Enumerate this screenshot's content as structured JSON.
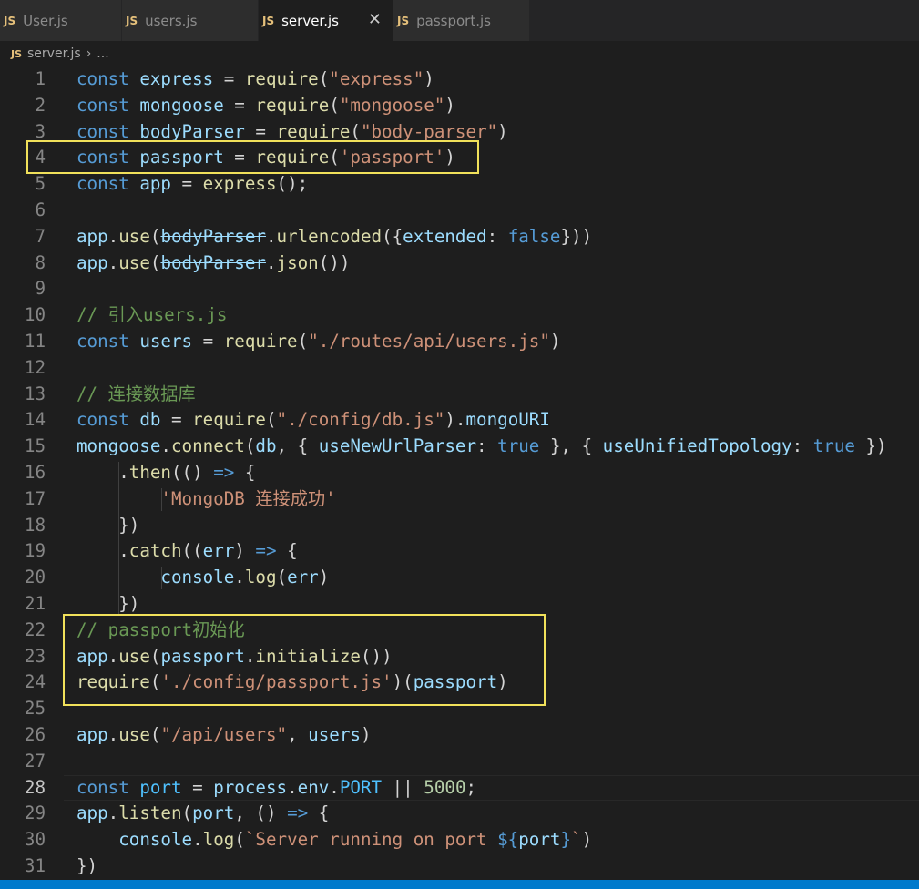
{
  "tabs": [
    {
      "icon": "JS",
      "label": "User.js",
      "active": false
    },
    {
      "icon": "JS",
      "label": "users.js",
      "active": false
    },
    {
      "icon": "JS",
      "label": "server.js",
      "active": true,
      "close": "✕"
    },
    {
      "icon": "JS",
      "label": "passport.js",
      "active": false
    }
  ],
  "breadcrumb": {
    "icon": "JS",
    "file": "server.js",
    "sep": "›",
    "more": "..."
  },
  "lines": [
    {
      "n": "1",
      "t": [
        [
          "kw",
          "const"
        ],
        [
          "p",
          " "
        ],
        [
          "var",
          "express"
        ],
        [
          "p",
          " = "
        ],
        [
          "fn",
          "require"
        ],
        [
          "p",
          "("
        ],
        [
          "str",
          "\"express\""
        ],
        [
          "p",
          ")"
        ]
      ]
    },
    {
      "n": "2",
      "t": [
        [
          "kw",
          "const"
        ],
        [
          "p",
          " "
        ],
        [
          "var",
          "mongoose"
        ],
        [
          "p",
          " = "
        ],
        [
          "fn",
          "require"
        ],
        [
          "p",
          "("
        ],
        [
          "str",
          "\"mongoose\""
        ],
        [
          "p",
          ")"
        ]
      ]
    },
    {
      "n": "3",
      "t": [
        [
          "kw",
          "const"
        ],
        [
          "p",
          " "
        ],
        [
          "var",
          "bodyParser"
        ],
        [
          "p",
          " = "
        ],
        [
          "fn",
          "require"
        ],
        [
          "p",
          "("
        ],
        [
          "str",
          "\"body-parser\""
        ],
        [
          "p",
          ")"
        ]
      ]
    },
    {
      "n": "4",
      "t": [
        [
          "kw",
          "const"
        ],
        [
          "p",
          " "
        ],
        [
          "var",
          "passport"
        ],
        [
          "p",
          " = "
        ],
        [
          "fn",
          "require"
        ],
        [
          "p",
          "("
        ],
        [
          "str",
          "'passport'"
        ],
        [
          "p",
          ")"
        ]
      ]
    },
    {
      "n": "5",
      "t": [
        [
          "kw",
          "const"
        ],
        [
          "p",
          " "
        ],
        [
          "var",
          "app"
        ],
        [
          "p",
          " = "
        ],
        [
          "fn",
          "express"
        ],
        [
          "p",
          "();"
        ]
      ]
    },
    {
      "n": "6",
      "t": []
    },
    {
      "n": "7",
      "t": [
        [
          "var",
          "app"
        ],
        [
          "p",
          "."
        ],
        [
          "fn",
          "use"
        ],
        [
          "p",
          "("
        ],
        [
          "var strike",
          "bodyParser"
        ],
        [
          "p",
          "."
        ],
        [
          "fn",
          "urlencoded"
        ],
        [
          "p",
          "({"
        ],
        [
          "var",
          "extended"
        ],
        [
          "p",
          ": "
        ],
        [
          "kw",
          "false"
        ],
        [
          "p",
          "}))"
        ]
      ]
    },
    {
      "n": "8",
      "t": [
        [
          "var",
          "app"
        ],
        [
          "p",
          "."
        ],
        [
          "fn",
          "use"
        ],
        [
          "p",
          "("
        ],
        [
          "var strike",
          "bodyParser"
        ],
        [
          "p",
          "."
        ],
        [
          "fn",
          "json"
        ],
        [
          "p",
          "())"
        ]
      ]
    },
    {
      "n": "9",
      "t": []
    },
    {
      "n": "10",
      "t": [
        [
          "cmt",
          "// 引入users.js"
        ]
      ]
    },
    {
      "n": "11",
      "t": [
        [
          "kw",
          "const"
        ],
        [
          "p",
          " "
        ],
        [
          "var",
          "users"
        ],
        [
          "p",
          " = "
        ],
        [
          "fn",
          "require"
        ],
        [
          "p",
          "("
        ],
        [
          "str",
          "\"./routes/api/users.js\""
        ],
        [
          "p",
          ")"
        ]
      ]
    },
    {
      "n": "12",
      "t": []
    },
    {
      "n": "13",
      "t": [
        [
          "cmt",
          "// 连接数据库"
        ]
      ]
    },
    {
      "n": "14",
      "t": [
        [
          "kw",
          "const"
        ],
        [
          "p",
          " "
        ],
        [
          "var",
          "db"
        ],
        [
          "p",
          " = "
        ],
        [
          "fn",
          "require"
        ],
        [
          "p",
          "("
        ],
        [
          "str",
          "\"./config/db.js\""
        ],
        [
          "p",
          ")."
        ],
        [
          "var",
          "mongoURI"
        ]
      ]
    },
    {
      "n": "15",
      "t": [
        [
          "var",
          "mongoose"
        ],
        [
          "p",
          "."
        ],
        [
          "fn",
          "connect"
        ],
        [
          "p",
          "("
        ],
        [
          "var",
          "db"
        ],
        [
          "p",
          ", { "
        ],
        [
          "var",
          "useNewUrlParser"
        ],
        [
          "p",
          ": "
        ],
        [
          "kw",
          "true"
        ],
        [
          "p",
          " }, { "
        ],
        [
          "var",
          "useUnifiedTopology"
        ],
        [
          "p",
          ": "
        ],
        [
          "kw",
          "true"
        ],
        [
          "p",
          " })"
        ]
      ]
    },
    {
      "n": "16",
      "t": [
        [
          "p",
          "    ."
        ],
        [
          "fn",
          "then"
        ],
        [
          "p",
          "(() "
        ],
        [
          "kw",
          "=>"
        ],
        [
          "p",
          " {"
        ]
      ]
    },
    {
      "n": "17",
      "t": [
        [
          "p",
          "        "
        ],
        [
          "str",
          "'MongoDB 连接成功'"
        ]
      ]
    },
    {
      "n": "18",
      "t": [
        [
          "p",
          "    })"
        ]
      ]
    },
    {
      "n": "19",
      "t": [
        [
          "p",
          "    ."
        ],
        [
          "fn",
          "catch"
        ],
        [
          "p",
          "(("
        ],
        [
          "var",
          "err"
        ],
        [
          "p",
          ") "
        ],
        [
          "kw",
          "=>"
        ],
        [
          "p",
          " {"
        ]
      ]
    },
    {
      "n": "20",
      "t": [
        [
          "p",
          "        "
        ],
        [
          "var",
          "console"
        ],
        [
          "p",
          "."
        ],
        [
          "fn",
          "log"
        ],
        [
          "p",
          "("
        ],
        [
          "var",
          "err"
        ],
        [
          "p",
          ")"
        ]
      ]
    },
    {
      "n": "21",
      "t": [
        [
          "p",
          "    })"
        ]
      ]
    },
    {
      "n": "22",
      "t": [
        [
          "cmt",
          "// passport初始化"
        ]
      ]
    },
    {
      "n": "23",
      "t": [
        [
          "var",
          "app"
        ],
        [
          "p",
          "."
        ],
        [
          "fn",
          "use"
        ],
        [
          "p",
          "("
        ],
        [
          "var",
          "passport"
        ],
        [
          "p",
          "."
        ],
        [
          "fn",
          "initialize"
        ],
        [
          "p",
          "())"
        ]
      ]
    },
    {
      "n": "24",
      "t": [
        [
          "fn",
          "require"
        ],
        [
          "p",
          "("
        ],
        [
          "str",
          "'./config/passport.js'"
        ],
        [
          "p",
          ")("
        ],
        [
          "var",
          "passport"
        ],
        [
          "p",
          ")"
        ]
      ]
    },
    {
      "n": "25",
      "t": []
    },
    {
      "n": "26",
      "t": [
        [
          "var",
          "app"
        ],
        [
          "p",
          "."
        ],
        [
          "fn",
          "use"
        ],
        [
          "p",
          "("
        ],
        [
          "str",
          "\"/api/users\""
        ],
        [
          "p",
          ", "
        ],
        [
          "var",
          "users"
        ],
        [
          "p",
          ")"
        ]
      ]
    },
    {
      "n": "27",
      "t": []
    },
    {
      "n": "28",
      "t": [
        [
          "kw",
          "const"
        ],
        [
          "p",
          " "
        ],
        [
          "const",
          "port"
        ],
        [
          "p",
          " = "
        ],
        [
          "var",
          "process"
        ],
        [
          "p",
          "."
        ],
        [
          "var",
          "env"
        ],
        [
          "p",
          "."
        ],
        [
          "const",
          "PORT"
        ],
        [
          "p",
          " || "
        ],
        [
          "num",
          "5000"
        ],
        [
          "p",
          ";"
        ]
      ]
    },
    {
      "n": "29",
      "t": [
        [
          "var",
          "app"
        ],
        [
          "p",
          "."
        ],
        [
          "fn",
          "listen"
        ],
        [
          "p",
          "("
        ],
        [
          "var",
          "port"
        ],
        [
          "p",
          ", () "
        ],
        [
          "kw",
          "=>"
        ],
        [
          "p",
          " {"
        ]
      ]
    },
    {
      "n": "30",
      "t": [
        [
          "p",
          "    "
        ],
        [
          "var",
          "console"
        ],
        [
          "p",
          "."
        ],
        [
          "fn",
          "log"
        ],
        [
          "p",
          "("
        ],
        [
          "str",
          "`Server running on port "
        ],
        [
          "kw",
          "${"
        ],
        [
          "var",
          "port"
        ],
        [
          "kw",
          "}"
        ],
        [
          "str",
          "`"
        ],
        [
          "p",
          ")"
        ]
      ]
    },
    {
      "n": "31",
      "t": [
        [
          "p",
          "})"
        ]
      ]
    }
  ],
  "current_line": "28",
  "colors": {
    "highlight_box": "#f0e05a",
    "status_bar": "#007acc"
  }
}
